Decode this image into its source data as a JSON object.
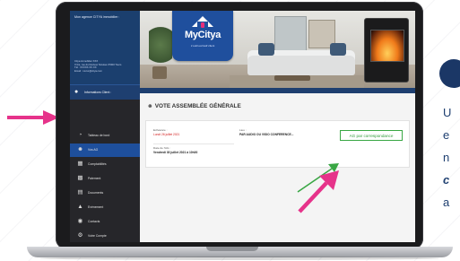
{
  "sidebar": {
    "agency_title": "Mon agence CITYA immobilier :",
    "agency_address_lines": [
      "Citya immobilier XXX",
      "X bis, rue du Docteur Nicolas 37000 Tours",
      "Tél : XXXXX.XX.XX",
      "Email : xxxxx@citya.com"
    ],
    "info_label": "Informations Client :",
    "items": [
      {
        "label": "Tableau de bord",
        "icon": "dashboard-icon",
        "active": false
      },
      {
        "label": "Vos AG",
        "icon": "users-icon",
        "active": true
      },
      {
        "label": "Comptabilités",
        "icon": "calculator-icon",
        "active": false
      },
      {
        "label": "Paiement",
        "icon": "cart-icon",
        "active": false
      },
      {
        "label": "Documents",
        "icon": "document-icon",
        "active": false
      },
      {
        "label": "Evènement",
        "icon": "warning-icon",
        "active": false
      },
      {
        "label": "Contacts",
        "icon": "chat-icon",
        "active": false
      },
      {
        "label": "Votre Compte",
        "icon": "gear-icon",
        "active": false
      }
    ]
  },
  "header": {
    "logo_word": "MyCitya",
    "logo_tagline": "L'outil exclusif client"
  },
  "main": {
    "section_title": "VOTE ASSEMBLÉE GÉNÉRALE",
    "card": {
      "deadline_label": "Echéance :",
      "deadline_value": "Lundi 26 juillet 2021",
      "place_label": "Lieu :",
      "place_value": "PAR AUDIO OU VISIO CONFERENCE...",
      "date_label": "Date de l'AG :",
      "date_value": "Vendredi 30 juillet 2021 à 10h00",
      "button_label": "AG par correspondance"
    }
  },
  "blurb": {
    "lines": [
      "U",
      "e",
      "n",
      "a"
    ],
    "emphasis_line": "c"
  },
  "colors": {
    "accent_pink": "#e6338a",
    "brand_blue": "#1f4f9d",
    "button_green": "#39a744"
  }
}
